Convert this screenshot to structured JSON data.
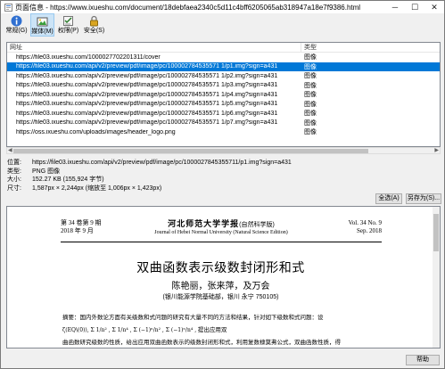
{
  "window": {
    "title": "页面信息 - https://www.ixueshu.com/document/18debfaea2340c5d11c4bff6205065ab318947a18e7f9386.html"
  },
  "toolbar": {
    "tabs": [
      {
        "label": "常规(G)",
        "icon": "info-icon"
      },
      {
        "label": "媒体(M)",
        "icon": "media-icon"
      },
      {
        "label": "权限(P)",
        "icon": "permissions-icon"
      },
      {
        "label": "安全(S)",
        "icon": "lock-icon"
      }
    ],
    "active_tab": "媒体(M)"
  },
  "media_list": {
    "columns": [
      "网址",
      "类型"
    ],
    "rows": [
      {
        "url": "https://file03.ixueshu.com/1000027702201311/cover",
        "type": "图像",
        "selected": false
      },
      {
        "url": "https://file03.ixueshu.com/api/v2/preview/pdf/image/pc/100002784535571 1/p1.img?sign=a431",
        "type": "图像",
        "selected": true
      },
      {
        "url": "https://file03.ixueshu.com/api/v2/preview/pdf/image/pc/100002784535571 1/p2.img?sign=a431",
        "type": "图像",
        "selected": false
      },
      {
        "url": "https://file03.ixueshu.com/api/v2/preview/pdf/image/pc/100002784535571 1/p3.img?sign=a431",
        "type": "图像",
        "selected": false
      },
      {
        "url": "https://file03.ixueshu.com/api/v2/preview/pdf/image/pc/100002784535571 1/p4.img?sign=a431",
        "type": "图像",
        "selected": false
      },
      {
        "url": "https://file03.ixueshu.com/api/v2/preview/pdf/image/pc/100002784535571 1/p5.img?sign=a431",
        "type": "图像",
        "selected": false
      },
      {
        "url": "https://file03.ixueshu.com/api/v2/preview/pdf/image/pc/100002784535571 1/p6.img?sign=a431",
        "type": "图像",
        "selected": false
      },
      {
        "url": "https://file03.ixueshu.com/api/v2/preview/pdf/image/pc/100002784535571 1/p7.img?sign=a431",
        "type": "图像",
        "selected": false
      },
      {
        "url": "https://oss.ixueshu.com/uploads/images/header_logo.png",
        "type": "图像",
        "selected": false
      }
    ]
  },
  "details": {
    "location_label": "位置:",
    "location_value": "https://file03.ixueshu.com/api/v2/preview/pdf/image/pc/1000027845355711/p1.img?sign=a431",
    "type_label": "类型:",
    "type_value": "PNG 图像",
    "size_label": "大小:",
    "size_value": "152.27 KB (155,924 字节)",
    "dims_label": "尺寸:",
    "dims_value": "1,587px × 2,244px (缩放至 1,006px × 1,423px)"
  },
  "buttons": {
    "select_all": "全选(A)",
    "save_as": "另存为(S)...",
    "help": "帮助"
  },
  "preview": {
    "issue_cn": "第 34 卷第 9 期",
    "date_cn": "2018 年 9 月",
    "journal_cn": "河北师范大学学报",
    "journal_cn_suffix": "(自然科学版)",
    "journal_en": "Journal of Hebei Normal University (Natural Science Edition)",
    "vol_en": "Vol. 34 No. 9",
    "date_en": "Sep. 2018",
    "title": "双曲函数表示级数封闭形和式",
    "authors": "陈艳丽，张来萍，及万会",
    "affiliation": "(银川能源学院基础部，银川 永宁 750105)",
    "abstract_line1": "摘要：国内外数论方面有关级数和式问题的研究有大量不同的方法和结果，针对如下级数和式问题：设",
    "abstract_line2_pre": "ζ(EQ\\(0)),",
    "abstract_line2_post": "提出应用双",
    "abstract_line3": "曲函数研究级数的性质，给出应用双曲函数表示的级数封闭形和式，利用复数棣莫弗公式，双曲函数性质，得"
  }
}
